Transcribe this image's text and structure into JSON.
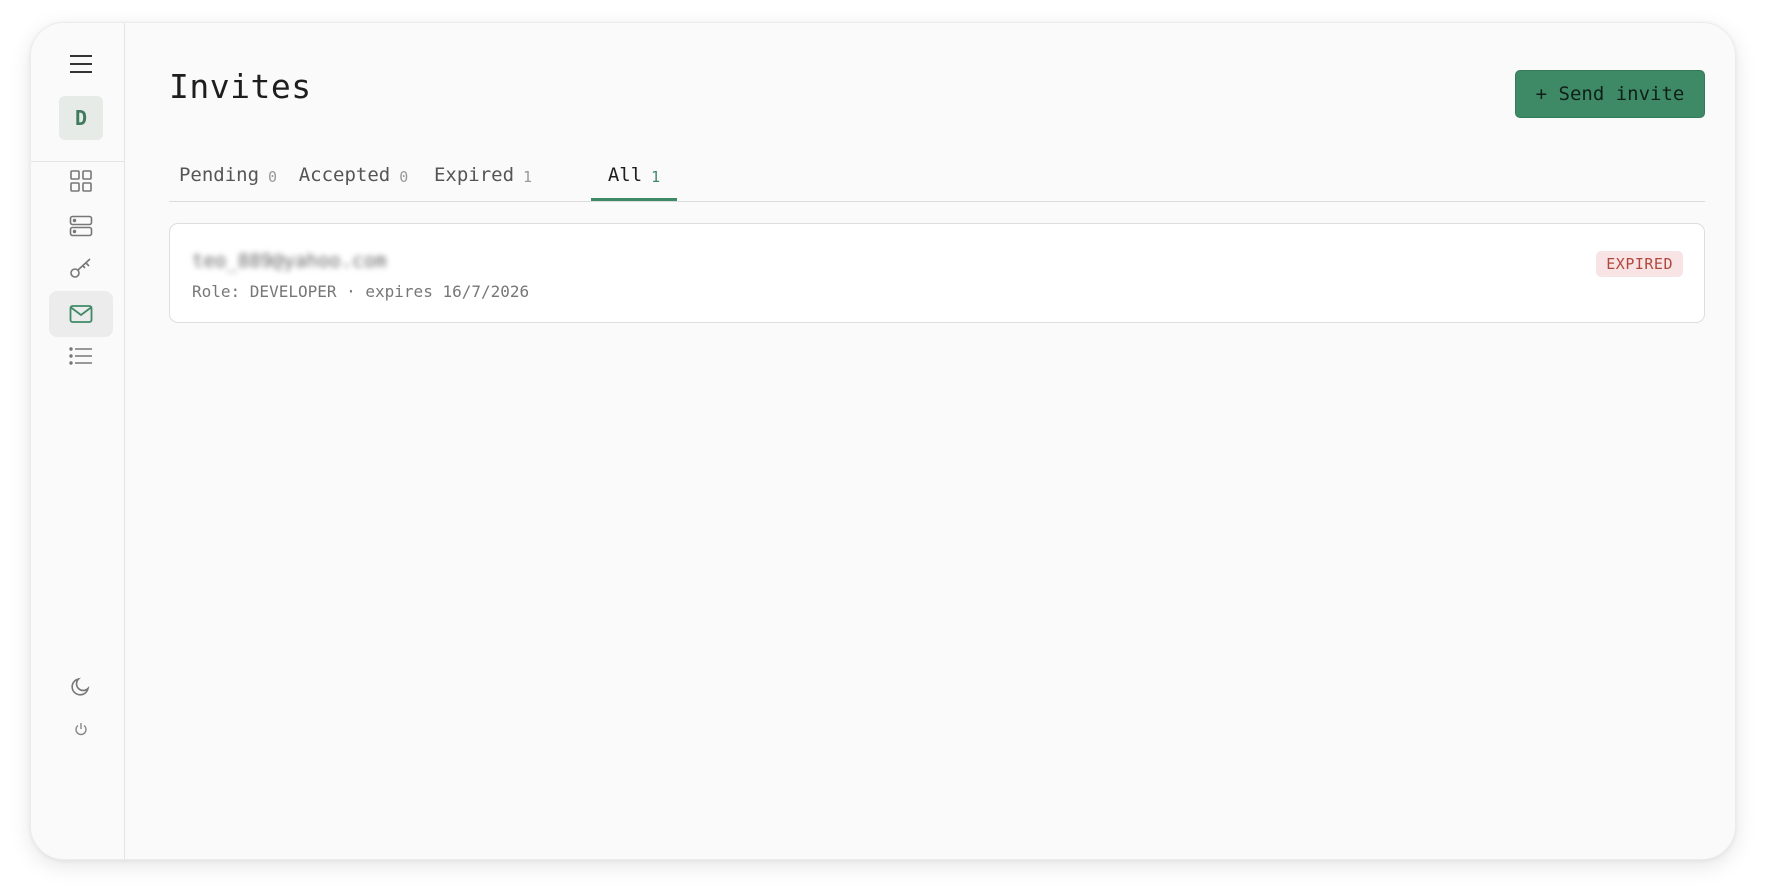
{
  "sidebar": {
    "avatar_initial": "D",
    "top_icons": [
      "menu-icon"
    ],
    "nav_items": [
      {
        "name": "dashboard",
        "icon": "grid-icon",
        "active": false
      },
      {
        "name": "servers",
        "icon": "server-icon",
        "active": false
      },
      {
        "name": "keys",
        "icon": "key-icon",
        "active": false
      },
      {
        "name": "invites",
        "icon": "mail-icon",
        "active": true
      },
      {
        "name": "logs",
        "icon": "list-icon",
        "active": false
      }
    ],
    "bottom_icons": [
      "moon-icon",
      "power-icon"
    ]
  },
  "header": {
    "title": "Invites",
    "send_invite_label": "+ Send invite"
  },
  "tabs": [
    {
      "label": "Pending",
      "count": "0",
      "active": false
    },
    {
      "label": "Accepted",
      "count": "0",
      "active": false
    },
    {
      "label": "Expired",
      "count": "1",
      "active": false
    },
    {
      "label": "All",
      "count": "1",
      "active": true
    }
  ],
  "invites": [
    {
      "email": "teo_889@yahoo.com",
      "meta": "Role: DEVELOPER · expires 16/7/2026",
      "status": "EXPIRED"
    }
  ],
  "colors": {
    "accent": "#3f8a66",
    "expired_badge_bg": "#f8e4e4",
    "expired_badge_text": "#b0473d"
  }
}
